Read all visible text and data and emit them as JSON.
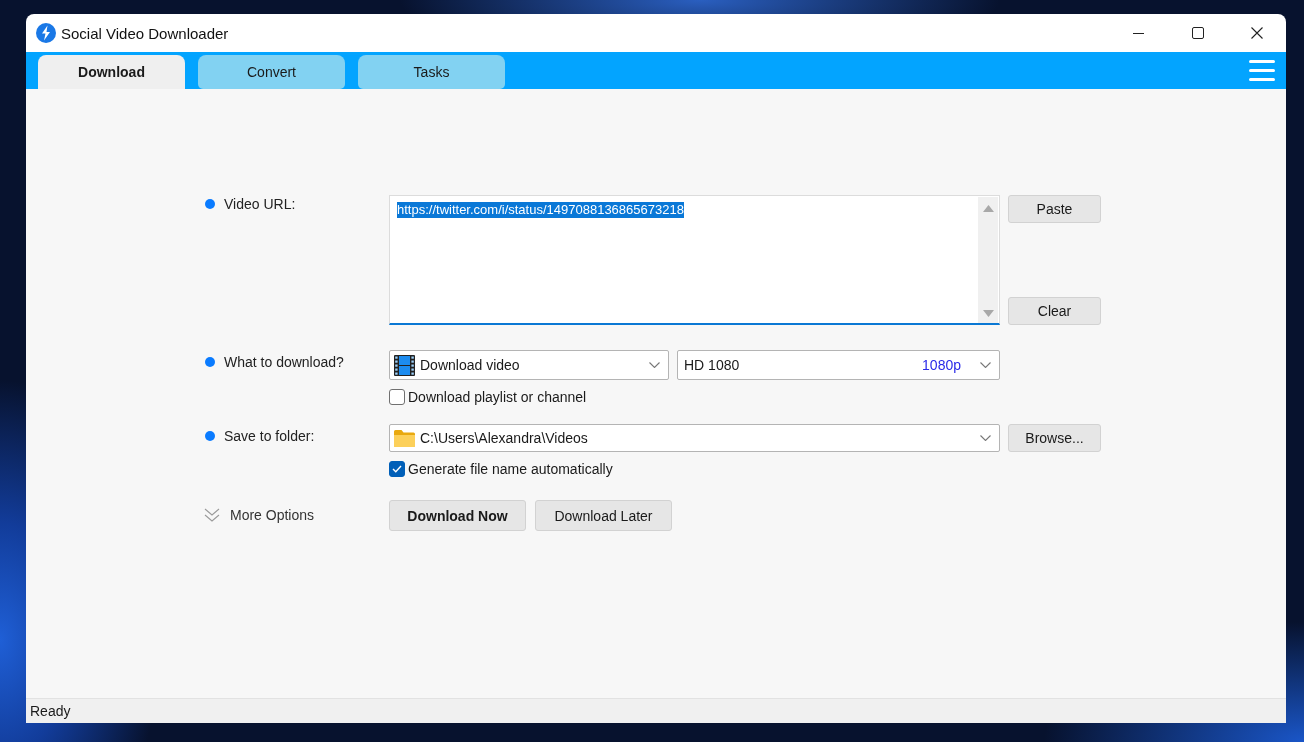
{
  "window": {
    "title": "Social Video Downloader"
  },
  "tabs": [
    {
      "label": "Download",
      "selected": true
    },
    {
      "label": "Convert",
      "selected": false
    },
    {
      "label": "Tasks",
      "selected": false
    }
  ],
  "form": {
    "video_url": {
      "label": "Video URL:",
      "value": "https://twitter.com/i/status/1497088136865673218",
      "text_selected": true
    },
    "paste_button": "Paste",
    "clear_button": "Clear",
    "what_to_download": {
      "label": "What to download?",
      "type": "Download video",
      "quality": "HD 1080",
      "quality_tag": "1080p"
    },
    "playlist_checkbox": {
      "label": "Download playlist or channel",
      "checked": false
    },
    "save_to_folder": {
      "label": "Save to folder:",
      "value": "C:\\Users\\Alexandra\\Videos"
    },
    "browse_button": "Browse...",
    "auto_name_checkbox": {
      "label": "Generate file name automatically",
      "checked": true
    },
    "more_options": {
      "label": "More Options",
      "expanded": false
    },
    "actions": [
      {
        "label": "Download Now",
        "default": true
      },
      {
        "label": "Download Later",
        "default": false
      }
    ]
  },
  "status_bar": {
    "text": "Ready"
  }
}
